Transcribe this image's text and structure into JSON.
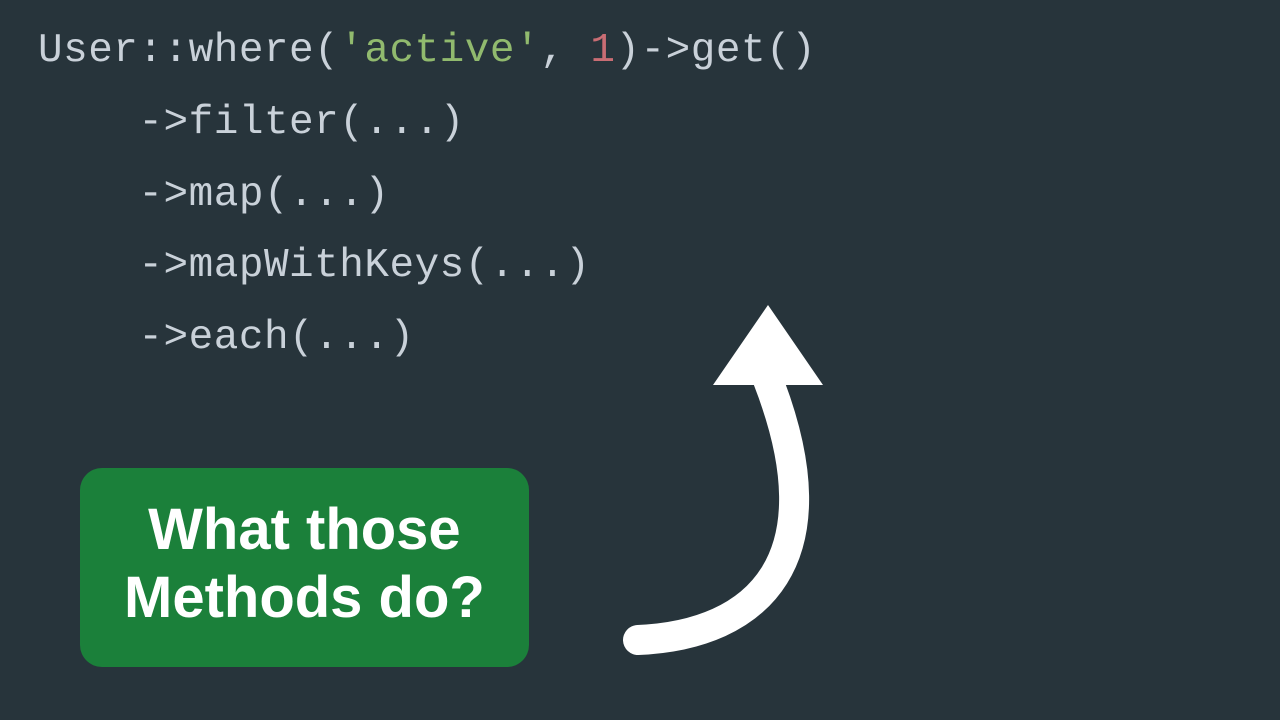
{
  "code": {
    "line1": {
      "a": "User::where(",
      "str": "'active'",
      "comma": ", ",
      "num": "1",
      "b": ")->get()"
    },
    "indent": "    ",
    "line2": "->filter(...)",
    "line3": "->map(...)",
    "line4": "->mapWithKeys(...)",
    "line5": "->each(...)"
  },
  "callout": {
    "line1": "What those",
    "line2": "Methods do?"
  }
}
